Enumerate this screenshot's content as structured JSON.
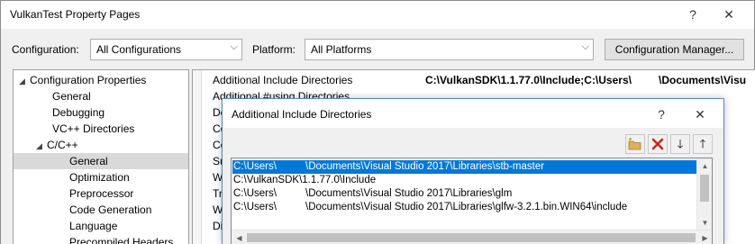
{
  "window": {
    "title": "VulkanTest Property Pages",
    "help_glyph": "?",
    "close_glyph": "✕"
  },
  "config_bar": {
    "configuration_label": "Configuration:",
    "configuration_value": "All Configurations",
    "platform_label": "Platform:",
    "platform_value": "All Platforms",
    "manager_button": "Configuration Manager..."
  },
  "tree": {
    "items": [
      {
        "label": "Configuration Properties",
        "expanded": true
      },
      {
        "label": "General"
      },
      {
        "label": "Debugging"
      },
      {
        "label": "VC++ Directories"
      },
      {
        "label": "C/C++",
        "expanded": true
      },
      {
        "label": "General",
        "selected": true
      },
      {
        "label": "Optimization"
      },
      {
        "label": "Preprocessor"
      },
      {
        "label": "Code Generation"
      },
      {
        "label": "Language"
      },
      {
        "label": "Precompiled Headers"
      }
    ]
  },
  "grid": {
    "rows": [
      {
        "name": "Additional Include Directories",
        "value": "C:\\VulkanSDK\\1.1.77.0\\Include;C:\\Users\\",
        "value2": "\\Documents\\Visu"
      },
      {
        "name": "Additional #using Directories"
      },
      {
        "name": "De"
      },
      {
        "name": "Co"
      },
      {
        "name": "Co"
      },
      {
        "name": "Su"
      },
      {
        "name": "W"
      },
      {
        "name": "Tre"
      },
      {
        "name": "W"
      },
      {
        "name": "Di"
      }
    ]
  },
  "dialog": {
    "title": "Additional Include Directories",
    "help_glyph": "?",
    "close_glyph": "✕",
    "toolbar": {
      "new_line_icon": "folder-new-icon",
      "delete_icon": "delete-icon",
      "move_down_glyph": "🡓",
      "move_up_glyph": "🡑",
      "delete_color": "#c42b1c"
    },
    "entries": [
      {
        "a": "C:\\Users\\",
        "b": "\\Documents\\Visual Studio 2017\\Libraries\\stb-master",
        "selected": true
      },
      {
        "a": "C:\\VulkanSDK\\1.1.77.0\\Include",
        "b": ""
      },
      {
        "a": "C:\\Users\\",
        "b": "\\Documents\\Visual Studio 2017\\Libraries\\glm"
      },
      {
        "a": "C:\\Users\\",
        "b": "\\Documents\\Visual Studio 2017\\Libraries\\glfw-3.2.1.bin.WIN64\\include"
      }
    ]
  }
}
